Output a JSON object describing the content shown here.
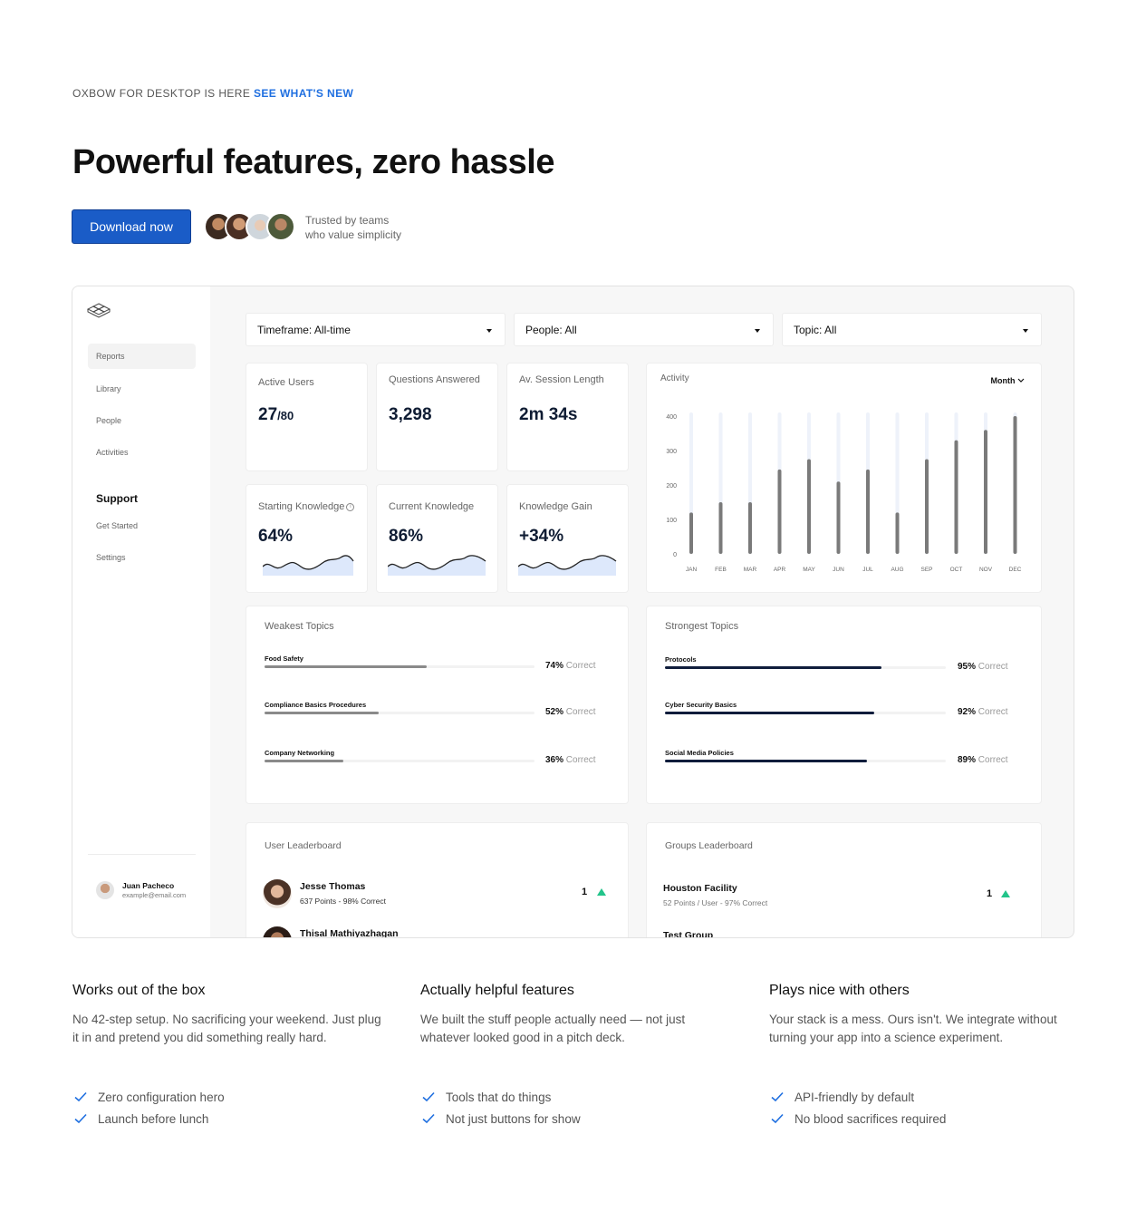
{
  "announcement": {
    "text": "OXBOW FOR DESKTOP IS HERE",
    "link": "SEE WHAT'S NEW"
  },
  "hero": {
    "title": "Powerful features, zero hassle",
    "cta": "Download now",
    "trust_line1": "Trusted by teams",
    "trust_line2": "who value simplicity"
  },
  "sidebar": {
    "items": [
      {
        "label": "Reports"
      },
      {
        "label": "Library"
      },
      {
        "label": "People"
      },
      {
        "label": "Activities"
      }
    ],
    "support_heading": "Support",
    "support_items": [
      {
        "label": "Get Started"
      },
      {
        "label": "Settings"
      }
    ],
    "user": {
      "name": "Juan Pacheco",
      "email": "example@email.com"
    }
  },
  "filters": [
    {
      "label": "Timeframe: All-time"
    },
    {
      "label": "People: All"
    },
    {
      "label": "Topic: All"
    }
  ],
  "stats": [
    {
      "label": "Active Users",
      "value": "27",
      "suffix": "/80"
    },
    {
      "label": "Questions Answered",
      "value": "3,298"
    },
    {
      "label": "Av. Session Length",
      "value": "2m 34s"
    },
    {
      "label": "Starting Knowledge",
      "value": "64%",
      "icon": "info-icon"
    },
    {
      "label": "Current Knowledge",
      "value": "86%"
    },
    {
      "label": "Knowledge Gain",
      "value": "+34%"
    }
  ],
  "activity": {
    "title": "Activity",
    "period": "Month"
  },
  "chart_data": {
    "type": "bar",
    "categories": [
      "JAN",
      "FEB",
      "MAR",
      "APR",
      "MAY",
      "JUN",
      "JUL",
      "AUG",
      "SEP",
      "OCT",
      "NOV",
      "DEC"
    ],
    "values": [
      120,
      150,
      150,
      245,
      275,
      210,
      245,
      120,
      275,
      330,
      360,
      400
    ],
    "yticks": [
      400,
      300,
      200,
      100,
      0
    ],
    "ylim": [
      0,
      400
    ],
    "bar_color": "#7a7a7a",
    "track_color": "#eef2fa"
  },
  "weakest_topics": {
    "title": "Weakest Topics",
    "items": [
      {
        "name": "Food Safety",
        "pct": 74,
        "pct_label": "74%",
        "suffix": "Correct"
      },
      {
        "name": "Compliance Basics Procedures",
        "pct": 52,
        "pct_label": "52%",
        "suffix": "Correct"
      },
      {
        "name": "Company Networking",
        "pct": 36,
        "pct_label": "36%",
        "suffix": "Correct"
      }
    ],
    "color": "#8a8a8a"
  },
  "strongest_topics": {
    "title": "Strongest Topics",
    "items": [
      {
        "name": "Protocols",
        "pct": 95,
        "pct_label": "95%",
        "suffix": "Correct"
      },
      {
        "name": "Cyber Security Basics",
        "pct": 92,
        "pct_label": "92%",
        "suffix": "Correct"
      },
      {
        "name": "Social Media Policies",
        "pct": 89,
        "pct_label": "89%",
        "suffix": "Correct"
      }
    ],
    "color": "#101d3c"
  },
  "user_leaderboard": {
    "title": "User Leaderboard",
    "rows": [
      {
        "name": "Jesse Thomas",
        "sub": "637 Points - 98% Correct",
        "rank": "1"
      },
      {
        "name": "Thisal Mathiyazhagan",
        "sub": "",
        "rank": ""
      }
    ]
  },
  "groups_leaderboard": {
    "title": "Groups Leaderboard",
    "rows": [
      {
        "name": "Houston Facility",
        "sub": "52 Points / User - 97% Correct",
        "rank": "1"
      },
      {
        "name": "Test Group",
        "sub": "",
        "rank": ""
      }
    ]
  },
  "features": [
    {
      "title": "Works out of the box",
      "body": "No 42-step setup. No sacrificing your weekend. Just plug it in and pretend you did something really hard.",
      "checks": [
        "Zero configuration hero",
        "Launch before lunch"
      ]
    },
    {
      "title": "Actually helpful features",
      "body": "We built the stuff people actually need — not just whatever looked good in a pitch deck.",
      "checks": [
        "Tools that do things",
        "Not just buttons for show"
      ]
    },
    {
      "title": "Plays nice with others",
      "body": "Your stack is a mess. Ours isn't. We integrate without turning your app into a science experiment.",
      "checks": [
        "API-friendly by default",
        "No blood sacrifices required"
      ]
    }
  ],
  "colors": {
    "accent": "#1a5cc7",
    "link": "#1f6fe0",
    "check": "#1f6fe0",
    "up": "#22c48a"
  }
}
